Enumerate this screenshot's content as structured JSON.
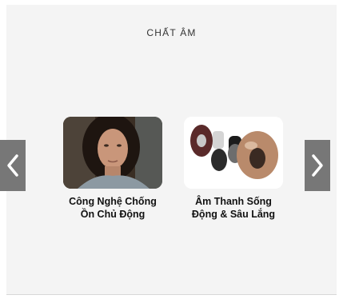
{
  "section": {
    "heading": "CHẤT ÂM"
  },
  "cards": [
    {
      "caption_line1": "Công Nghệ Chống",
      "caption_line2": "Ồn Chủ Động",
      "image": "woman-portrait"
    },
    {
      "caption_line1": "Âm Thanh Sống",
      "caption_line2": "Động & Sâu Lắng",
      "image": "galaxy-buds-live"
    }
  ],
  "nav": {
    "prev_icon": "chevron-left-icon",
    "next_icon": "chevron-right-icon"
  },
  "colors": {
    "panel_bg": "#f4f4f4",
    "arrow_bg": "#777777",
    "buds_bronze": "#b98a6b"
  }
}
